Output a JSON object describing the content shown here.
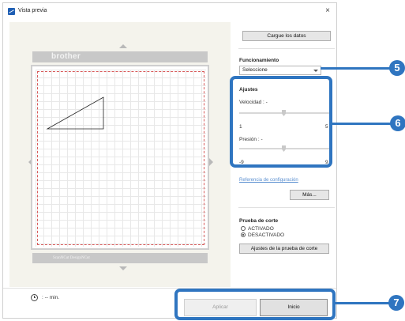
{
  "window": {
    "title": "Vista previa",
    "close_glyph": "×"
  },
  "preview": {
    "brand": "brother",
    "bottom_text": "ScanNCut   DesignNCut"
  },
  "panel": {
    "load_button": "Cargue los datos",
    "funcionamiento": {
      "heading": "Funcionamiento",
      "select_value": "Seleccione"
    },
    "ajustes": {
      "heading": "Ajustes",
      "velocidad": {
        "label": "Velocidad : -",
        "min": "1",
        "max": "5"
      },
      "presion": {
        "label": "Presión : -",
        "min": "-9",
        "max": "9"
      }
    },
    "config_link": "Referencia de configuración",
    "more_button": "Más...",
    "prueba": {
      "heading": "Prueba de corte",
      "options": [
        {
          "label": "ACTIVADO",
          "selected": false
        },
        {
          "label": "DESACTIVADO",
          "selected": true
        }
      ],
      "settings_button": "Ajustes de la prueba de corte"
    }
  },
  "footer": {
    "time": ": -- min.",
    "apply_button": "Aplicar",
    "start_button": "Inicio"
  },
  "callouts": [
    "5",
    "6",
    "7"
  ],
  "icons": [
    "app-icon",
    "close-icon",
    "clock-icon"
  ],
  "colors": {
    "callout": "#2f75c0",
    "link": "#5a8fd0",
    "mat_boundary": "#d85a5a"
  }
}
